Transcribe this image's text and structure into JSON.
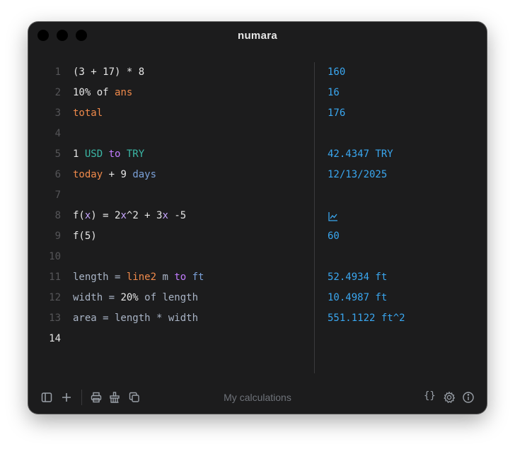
{
  "window": {
    "title": "numara"
  },
  "lines": [
    {
      "n": "1",
      "tokens": [
        [
          "(3 + 17) * 8",
          "num"
        ]
      ]
    },
    {
      "n": "2",
      "tokens": [
        [
          "10% of ",
          "num"
        ],
        [
          "ans",
          "kw"
        ]
      ]
    },
    {
      "n": "3",
      "tokens": [
        [
          "total",
          "kw"
        ]
      ]
    },
    {
      "n": "4",
      "tokens": []
    },
    {
      "n": "5",
      "tokens": [
        [
          "1 ",
          "num"
        ],
        [
          "USD ",
          "unit"
        ],
        [
          "to ",
          "to"
        ],
        [
          "TRY",
          "unit"
        ]
      ]
    },
    {
      "n": "6",
      "tokens": [
        [
          "today",
          "kw"
        ],
        [
          " + 9 ",
          "num"
        ],
        [
          "days",
          "day"
        ]
      ]
    },
    {
      "n": "7",
      "tokens": []
    },
    {
      "n": "8",
      "tokens": [
        [
          "f(",
          "fn"
        ],
        [
          "x",
          "x"
        ],
        [
          ") = 2",
          "fn"
        ],
        [
          "x",
          "x"
        ],
        [
          "^2 + 3",
          "fn"
        ],
        [
          "x",
          "x"
        ],
        [
          " -5",
          "fn"
        ]
      ]
    },
    {
      "n": "9",
      "tokens": [
        [
          "f(5)",
          "fn"
        ]
      ]
    },
    {
      "n": "10",
      "tokens": []
    },
    {
      "n": "11",
      "tokens": [
        [
          "length = ",
          "var"
        ],
        [
          "line2",
          "kw"
        ],
        [
          " m ",
          "var"
        ],
        [
          "to ",
          "to"
        ],
        [
          "ft",
          "day"
        ]
      ]
    },
    {
      "n": "12",
      "tokens": [
        [
          "width = ",
          "var"
        ],
        [
          "20%",
          "num"
        ],
        [
          " of length",
          "var"
        ]
      ]
    },
    {
      "n": "13",
      "tokens": [
        [
          "area = length * width",
          "var"
        ]
      ]
    },
    {
      "n": "14",
      "tokens": [],
      "active": true
    }
  ],
  "results": [
    {
      "row": 0,
      "text": "160"
    },
    {
      "row": 1,
      "text": "16"
    },
    {
      "row": 2,
      "text": "176"
    },
    {
      "row": 4,
      "text": "42.4347 TRY"
    },
    {
      "row": 5,
      "text": "12/13/2025"
    },
    {
      "row": 7,
      "icon": "chart-icon"
    },
    {
      "row": 8,
      "text": "60"
    },
    {
      "row": 10,
      "text": "52.4934 ft"
    },
    {
      "row": 11,
      "text": "10.4987 ft"
    },
    {
      "row": 12,
      "text": "551.1122 ft^2"
    }
  ],
  "statusbar": {
    "filename": "My calculations",
    "braces": "{}",
    "icons": [
      "sidebar-icon",
      "plus-icon",
      "print-icon",
      "clear-icon",
      "copy-icon",
      "gear-icon",
      "info-icon"
    ]
  },
  "colors": {
    "background": "#1c1c1d",
    "result": "#3aa7f0",
    "keyword": "#f08a4b",
    "unit": "#3bb7a6",
    "conversion": "#c27cff"
  }
}
